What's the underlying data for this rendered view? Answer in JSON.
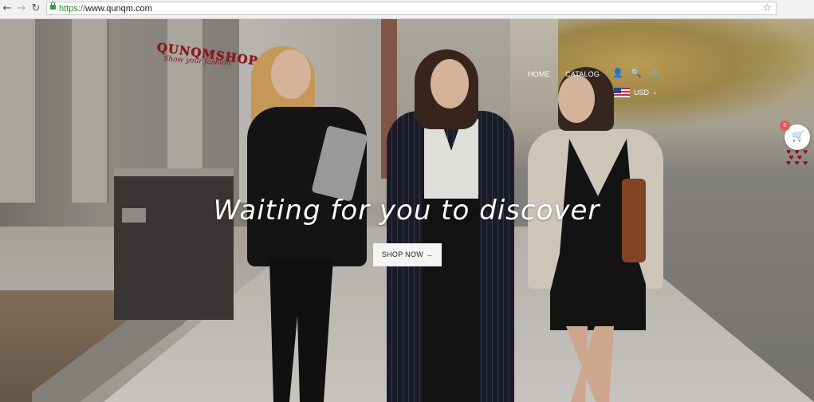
{
  "browser": {
    "back_icon": "←",
    "forward_icon": "→",
    "reload_icon": "↻",
    "url_scheme": "https://",
    "url_rest": "www.qunqm.com",
    "bookmark_icon": "☆"
  },
  "site": {
    "logo_text": "QUNQMSHOP",
    "logo_tagline": "Show your fashion",
    "nav": {
      "home": "HOME",
      "catalog": "CATALOG"
    },
    "icons": {
      "user": "👤",
      "search": "🔍",
      "cart": "🛒"
    },
    "currency": "USD",
    "currency_chevron": "⌄",
    "hero": {
      "headline": "Waiting for you to discover",
      "cta": "SHOP NOW →"
    },
    "floating_cart": {
      "icon": "🛒",
      "count": "0"
    },
    "colors": {
      "logo": "#8b1414",
      "badge": "#e8565b",
      "button_bg": "#f4f4f4"
    }
  }
}
